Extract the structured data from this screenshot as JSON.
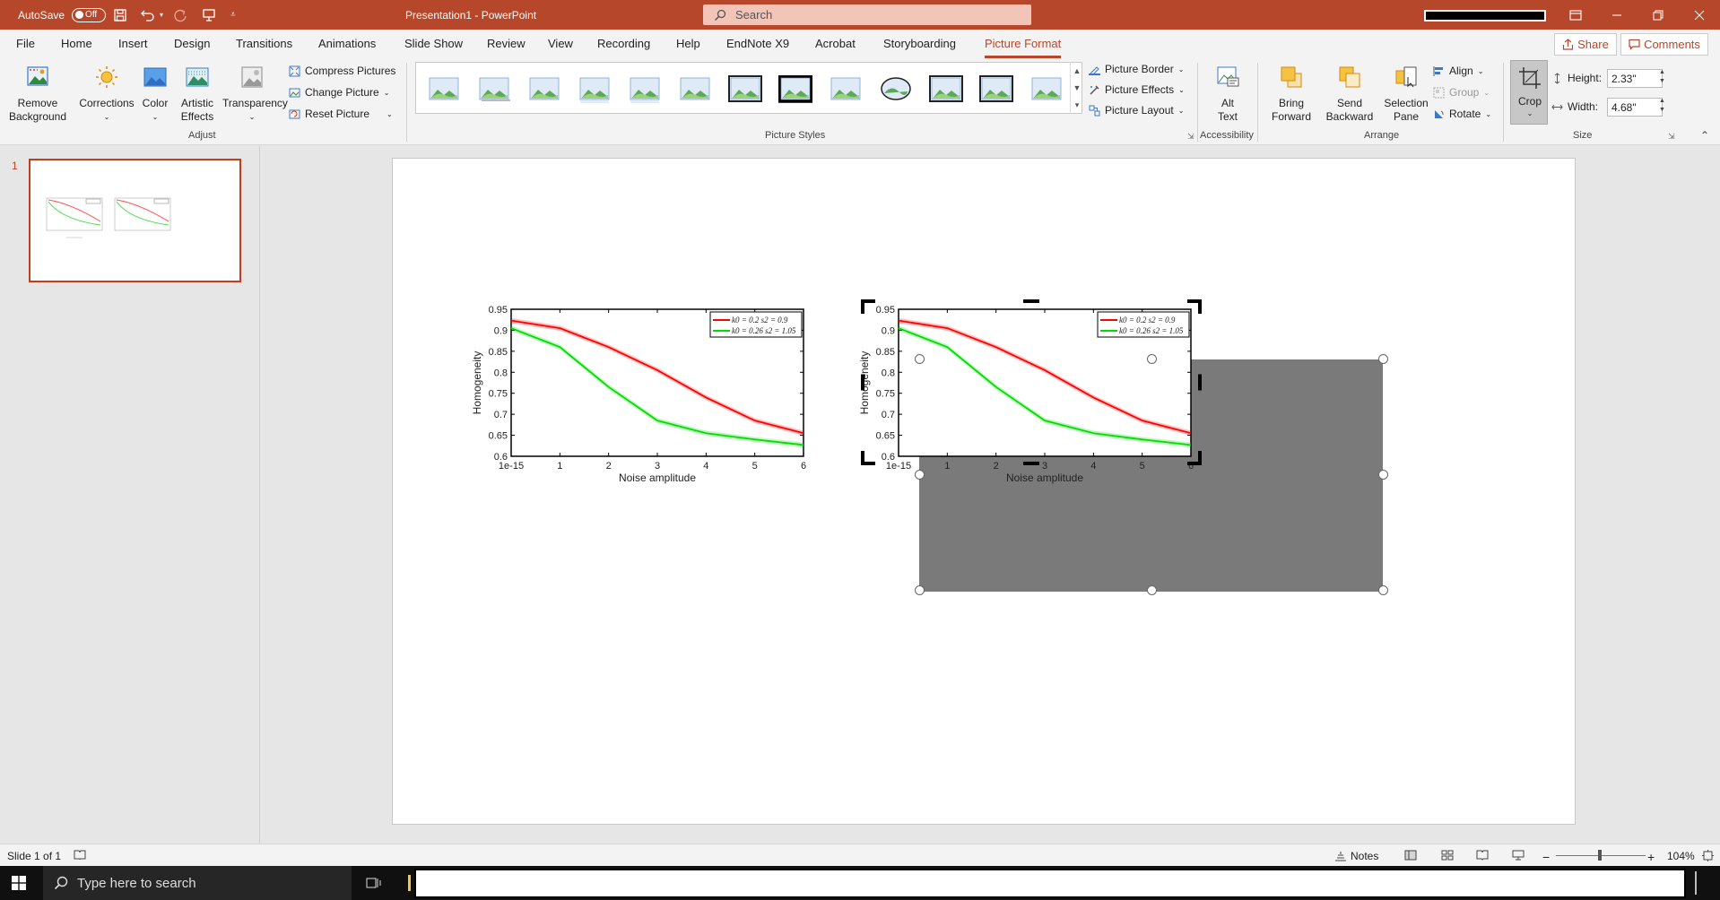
{
  "titlebar": {
    "autosave_label": "AutoSave",
    "autosave_state": "Off",
    "doc_title": "Presentation1  -  PowerPoint",
    "search_placeholder": "Search"
  },
  "menu": {
    "items": [
      "File",
      "Home",
      "Insert",
      "Design",
      "Transitions",
      "Animations",
      "Slide Show",
      "Review",
      "View",
      "Recording",
      "Help",
      "EndNote X9",
      "Acrobat",
      "Storyboarding",
      "Picture Format"
    ],
    "active": "Picture Format",
    "share_label": "Share",
    "comments_label": "Comments"
  },
  "ribbon": {
    "adjust": {
      "remove_background": [
        "Remove",
        "Background"
      ],
      "corrections": "Corrections",
      "color": "Color",
      "artistic_effects": [
        "Artistic",
        "Effects"
      ],
      "transparency": "Transparency",
      "compress_pictures": "Compress Pictures",
      "change_picture": "Change Picture",
      "reset_picture": "Reset Picture",
      "group_label": "Adjust"
    },
    "picture_styles": {
      "picture_border": "Picture Border",
      "picture_effects": "Picture Effects",
      "picture_layout": "Picture Layout",
      "group_label": "Picture Styles"
    },
    "accessibility": {
      "alt_text": [
        "Alt",
        "Text"
      ],
      "group_label": "Accessibility"
    },
    "arrange": {
      "bring_forward": [
        "Bring",
        "Forward"
      ],
      "send_backward": [
        "Send",
        "Backward"
      ],
      "selection_pane": [
        "Selection",
        "Pane"
      ],
      "align": "Align",
      "group": "Group",
      "rotate": "Rotate",
      "group_label": "Arrange"
    },
    "size": {
      "crop": "Crop",
      "height_label": "Height:",
      "height_value": "2.33\"",
      "width_label": "Width:",
      "width_value": "4.68\"",
      "group_label": "Size"
    }
  },
  "thumbnail": {
    "number": "1"
  },
  "chart_data": [
    {
      "type": "line",
      "categories": [
        "1e-15",
        "1",
        "2",
        "3",
        "4",
        "5",
        "6"
      ],
      "series": [
        {
          "name": "k0 = 0.2   s2 = 0.9",
          "color": "#ff0000",
          "values": [
            0.923,
            0.905,
            0.86,
            0.805,
            0.74,
            0.685,
            0.655
          ]
        },
        {
          "name": "k0 = 0.26   s2 = 1.05",
          "color": "#00dd00",
          "values": [
            0.905,
            0.86,
            0.765,
            0.685,
            0.655,
            0.64,
            0.627
          ]
        }
      ],
      "xlabel": "Noise amplitude",
      "ylabel": "Homogeneity",
      "ylim": [
        0.6,
        0.95
      ],
      "yticks": [
        "0.95",
        "0.9",
        "0.85",
        "0.8",
        "0.75",
        "0.7",
        "0.65",
        "0.6"
      ],
      "legend": "top-right",
      "grid": false
    },
    {
      "type": "line",
      "categories": [
        "1e-15",
        "1",
        "2",
        "3",
        "4",
        "5",
        "6"
      ],
      "series": [
        {
          "name": "k0 = 0.2   s2 = 0.9",
          "color": "#ff0000",
          "values": [
            0.923,
            0.905,
            0.86,
            0.805,
            0.74,
            0.685,
            0.655
          ]
        },
        {
          "name": "k0 = 0.26   s2 = 1.05",
          "color": "#00dd00",
          "values": [
            0.905,
            0.86,
            0.765,
            0.685,
            0.655,
            0.64,
            0.627
          ]
        }
      ],
      "xlabel": "Noise amplitude",
      "ylabel": "Homogeneity",
      "ylim": [
        0.6,
        0.95
      ],
      "yticks": [
        "0.95",
        "0.9",
        "0.85",
        "0.8",
        "0.75",
        "0.7",
        "0.65",
        "0.6"
      ],
      "legend": "top-right",
      "grid": false,
      "state": "cropping"
    }
  ],
  "statusbar": {
    "slide_info": "Slide 1 of 1",
    "notes_label": "Notes",
    "zoom_level": "104%",
    "zoom_minus": "−",
    "zoom_plus": "+"
  },
  "taskbar": {
    "search_placeholder": "Type here to search"
  },
  "colors": {
    "accent": "#b7472a",
    "crop_mask": "#7a7a7a"
  }
}
